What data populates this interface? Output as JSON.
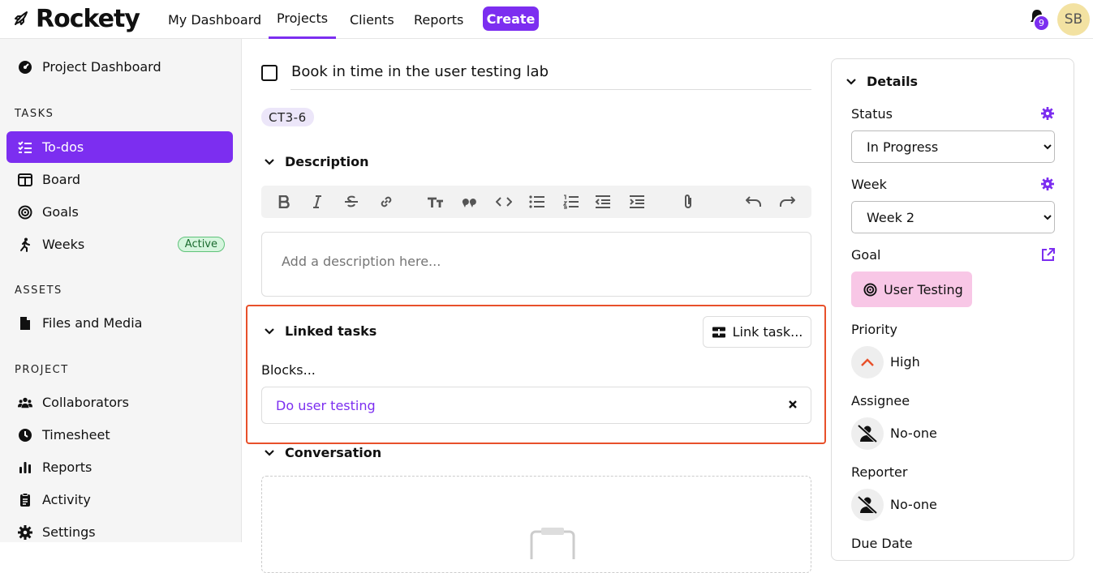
{
  "app": {
    "name": "Rockety"
  },
  "topnav": {
    "items": [
      "My Dashboard",
      "Projects",
      "Clients",
      "Reports"
    ],
    "create_label": "Create",
    "notification_count": "9",
    "avatar_initials": "SB"
  },
  "sidebar": {
    "project_dashboard": "Project Dashboard",
    "tasks_heading": "TASKS",
    "todos": "To-dos",
    "board": "Board",
    "goals": "Goals",
    "weeks": "Weeks",
    "weeks_badge": "Active",
    "assets_heading": "ASSETS",
    "files_media": "Files and Media",
    "project_heading": "PROJECT",
    "collaborators": "Collaborators",
    "timesheet": "Timesheet",
    "reports": "Reports",
    "activity": "Activity",
    "settings": "Settings"
  },
  "task": {
    "title": "Book in time in the user testing lab",
    "key": "CT3-6",
    "description_heading": "Description",
    "description_placeholder": "Add a description here...",
    "linked_heading": "Linked tasks",
    "link_button": "Link task...",
    "blocks_label": "Blocks...",
    "linked_items": [
      "Do user testing"
    ],
    "conversation_heading": "Conversation"
  },
  "details": {
    "heading": "Details",
    "status_label": "Status",
    "status_value": "In Progress",
    "week_label": "Week",
    "week_value": "Week 2",
    "goal_label": "Goal",
    "goal_value": "User Testing",
    "priority_label": "Priority",
    "priority_value": "High",
    "assignee_label": "Assignee",
    "assignee_value": "No-one",
    "reporter_label": "Reporter",
    "reporter_value": "No-one",
    "due_label": "Due Date"
  },
  "colors": {
    "accent": "#7c2ef0",
    "highlight_border": "#e8502a",
    "goal_pill": "#f8c7e6",
    "active_badge": "#d5f5dd"
  }
}
